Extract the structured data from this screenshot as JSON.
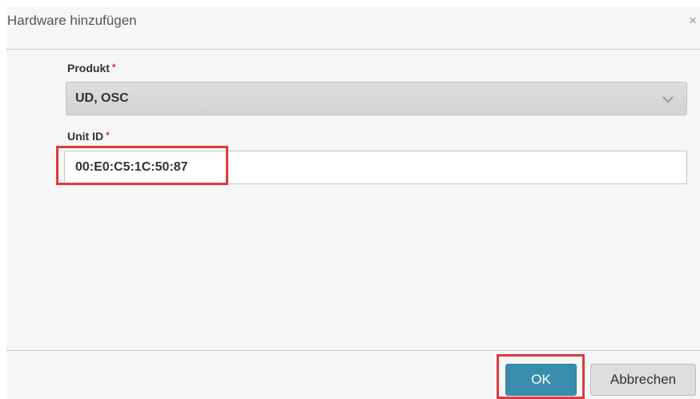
{
  "dialog": {
    "title": "Hardware hinzufügen",
    "close_symbol": "×"
  },
  "form": {
    "product": {
      "label": "Produkt",
      "required_mark": "*",
      "value": "UD, OSC",
      "icon": "chevron-down-icon"
    },
    "unit_id": {
      "label": "Unit ID",
      "required_mark": "*",
      "value": "00:E0:C5:1C:50:87"
    }
  },
  "footer": {
    "ok_label": "OK",
    "cancel_label": "Abbrechen"
  },
  "colors": {
    "primary": "#3a8dad",
    "highlight": "#e03a3e",
    "required": "#e03030"
  }
}
